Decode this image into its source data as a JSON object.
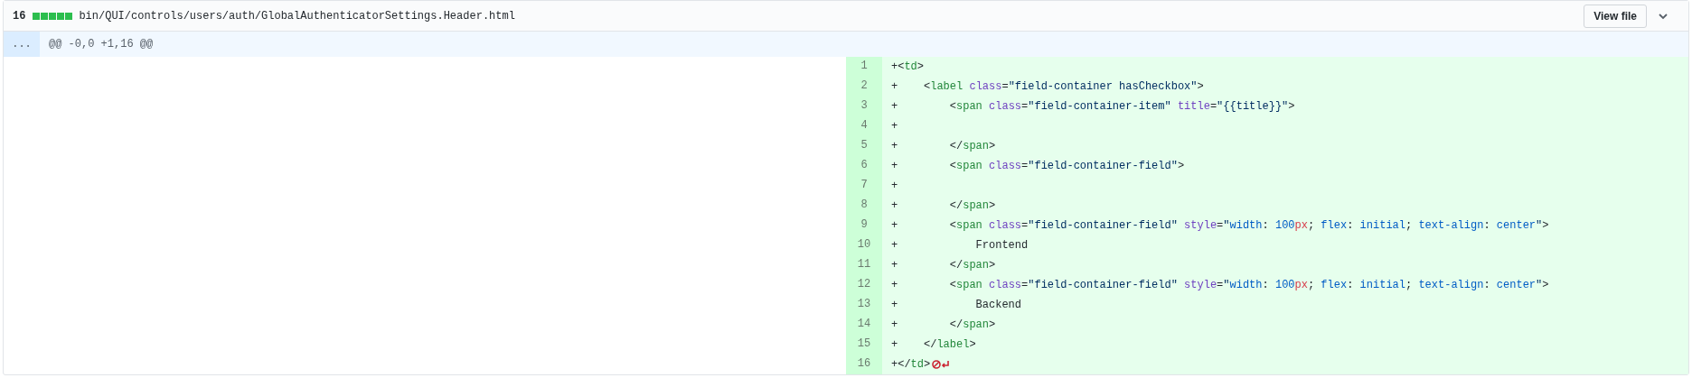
{
  "file_header": {
    "changes": "16",
    "diffstat": [
      {
        "kind": "added"
      },
      {
        "kind": "added"
      },
      {
        "kind": "added"
      },
      {
        "kind": "added"
      },
      {
        "kind": "added"
      }
    ],
    "path": "bin/QUI/controls/users/auth/GlobalAuthenticatorSettings.Header.html",
    "view_button": "View file",
    "expanded": true
  },
  "hunk": {
    "expander": "...",
    "header": "@@ -0,0 +1,16 @@"
  },
  "lines": [
    {
      "number": "1",
      "tokens": [
        {
          "kind": "plain",
          "text": "+<"
        },
        {
          "kind": "tag",
          "text": "td"
        },
        {
          "kind": "plain",
          "text": ">"
        }
      ]
    },
    {
      "number": "2",
      "tokens": [
        {
          "kind": "plain",
          "text": "+    <"
        },
        {
          "kind": "tag",
          "text": "label"
        },
        {
          "kind": "attr",
          "text": " class"
        },
        {
          "kind": "plain",
          "text": "="
        },
        {
          "kind": "string",
          "text": "\"field-container hasCheckbox\""
        },
        {
          "kind": "plain",
          "text": ">"
        }
      ]
    },
    {
      "number": "3",
      "tokens": [
        {
          "kind": "plain",
          "text": "+        <"
        },
        {
          "kind": "tag",
          "text": "span"
        },
        {
          "kind": "attr",
          "text": " class"
        },
        {
          "kind": "plain",
          "text": "="
        },
        {
          "kind": "string",
          "text": "\"field-container-item\""
        },
        {
          "kind": "attr",
          "text": " title"
        },
        {
          "kind": "plain",
          "text": "="
        },
        {
          "kind": "string",
          "text": "\"{{title}}\""
        },
        {
          "kind": "plain",
          "text": ">"
        }
      ]
    },
    {
      "number": "4",
      "tokens": [
        {
          "kind": "plain",
          "text": "+"
        }
      ]
    },
    {
      "number": "5",
      "tokens": [
        {
          "kind": "plain",
          "text": "+        </"
        },
        {
          "kind": "tag",
          "text": "span"
        },
        {
          "kind": "plain",
          "text": ">"
        }
      ]
    },
    {
      "number": "6",
      "tokens": [
        {
          "kind": "plain",
          "text": "+        <"
        },
        {
          "kind": "tag",
          "text": "span"
        },
        {
          "kind": "attr",
          "text": " class"
        },
        {
          "kind": "plain",
          "text": "="
        },
        {
          "kind": "string",
          "text": "\"field-container-field\""
        },
        {
          "kind": "plain",
          "text": ">"
        }
      ]
    },
    {
      "number": "7",
      "tokens": [
        {
          "kind": "plain",
          "text": "+"
        }
      ]
    },
    {
      "number": "8",
      "tokens": [
        {
          "kind": "plain",
          "text": "+        </"
        },
        {
          "kind": "tag",
          "text": "span"
        },
        {
          "kind": "plain",
          "text": ">"
        }
      ]
    },
    {
      "number": "9",
      "tokens": [
        {
          "kind": "plain",
          "text": "+        <"
        },
        {
          "kind": "tag",
          "text": "span"
        },
        {
          "kind": "attr",
          "text": " class"
        },
        {
          "kind": "plain",
          "text": "="
        },
        {
          "kind": "string",
          "text": "\"field-container-field\""
        },
        {
          "kind": "attr",
          "text": " style"
        },
        {
          "kind": "plain",
          "text": "="
        },
        {
          "kind": "string",
          "text": "\""
        },
        {
          "kind": "prop",
          "text": "width"
        },
        {
          "kind": "plain",
          "text": ": "
        },
        {
          "kind": "prop",
          "text": "100"
        },
        {
          "kind": "unit",
          "text": "px"
        },
        {
          "kind": "plain",
          "text": "; "
        },
        {
          "kind": "prop",
          "text": "flex"
        },
        {
          "kind": "plain",
          "text": ": "
        },
        {
          "kind": "prop",
          "text": "initial"
        },
        {
          "kind": "plain",
          "text": "; "
        },
        {
          "kind": "prop",
          "text": "text-align"
        },
        {
          "kind": "plain",
          "text": ": "
        },
        {
          "kind": "prop",
          "text": "center"
        },
        {
          "kind": "string",
          "text": "\""
        },
        {
          "kind": "plain",
          "text": ">"
        }
      ]
    },
    {
      "number": "10",
      "tokens": [
        {
          "kind": "plain",
          "text": "+            Frontend"
        }
      ]
    },
    {
      "number": "11",
      "tokens": [
        {
          "kind": "plain",
          "text": "+        </"
        },
        {
          "kind": "tag",
          "text": "span"
        },
        {
          "kind": "plain",
          "text": ">"
        }
      ]
    },
    {
      "number": "12",
      "tokens": [
        {
          "kind": "plain",
          "text": "+        <"
        },
        {
          "kind": "tag",
          "text": "span"
        },
        {
          "kind": "attr",
          "text": " class"
        },
        {
          "kind": "plain",
          "text": "="
        },
        {
          "kind": "string",
          "text": "\"field-container-field\""
        },
        {
          "kind": "attr",
          "text": " style"
        },
        {
          "kind": "plain",
          "text": "="
        },
        {
          "kind": "string",
          "text": "\""
        },
        {
          "kind": "prop",
          "text": "width"
        },
        {
          "kind": "plain",
          "text": ": "
        },
        {
          "kind": "prop",
          "text": "100"
        },
        {
          "kind": "unit",
          "text": "px"
        },
        {
          "kind": "plain",
          "text": "; "
        },
        {
          "kind": "prop",
          "text": "flex"
        },
        {
          "kind": "plain",
          "text": ": "
        },
        {
          "kind": "prop",
          "text": "initial"
        },
        {
          "kind": "plain",
          "text": "; "
        },
        {
          "kind": "prop",
          "text": "text-align"
        },
        {
          "kind": "plain",
          "text": ": "
        },
        {
          "kind": "prop",
          "text": "center"
        },
        {
          "kind": "string",
          "text": "\""
        },
        {
          "kind": "plain",
          "text": ">"
        }
      ]
    },
    {
      "number": "13",
      "tokens": [
        {
          "kind": "plain",
          "text": "+            Backend"
        }
      ]
    },
    {
      "number": "14",
      "tokens": [
        {
          "kind": "plain",
          "text": "+        </"
        },
        {
          "kind": "tag",
          "text": "span"
        },
        {
          "kind": "plain",
          "text": ">"
        }
      ]
    },
    {
      "number": "15",
      "tokens": [
        {
          "kind": "plain",
          "text": "+    </"
        },
        {
          "kind": "tag",
          "text": "label"
        },
        {
          "kind": "plain",
          "text": ">"
        }
      ]
    },
    {
      "number": "16",
      "no_newline": true,
      "tokens": [
        {
          "kind": "plain",
          "text": "+</"
        },
        {
          "kind": "tag",
          "text": "td"
        },
        {
          "kind": "plain",
          "text": ">"
        }
      ]
    }
  ]
}
